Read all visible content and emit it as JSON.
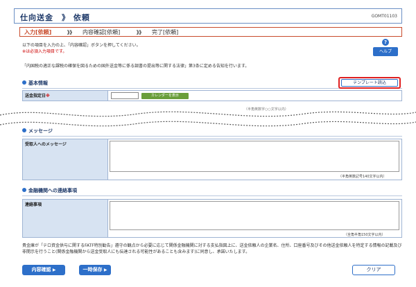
{
  "header": {
    "title": "仕向送金　》 依頼",
    "screen_id": "GOMT01103"
  },
  "steps": {
    "step1": "入力[依頼]",
    "sep": "》》",
    "step2": "内容確認[依頼]",
    "step3": "完了[依頼]"
  },
  "intro": {
    "line1": "以下の項目を入力の上、「内容確認」ボタンを押してください。",
    "line2": "※は必須入力項目です。",
    "law": "「内国税の適正な課税の確保を図るための国外送金等に係る調書の提出等に関する法律」第3条に定める告知を行います。"
  },
  "help": {
    "q": "?",
    "label": "ヘルプ"
  },
  "basic": {
    "title": "基本情報",
    "template_button": "テンプレート読込",
    "date_label": "送金指定日",
    "req_mark": "※",
    "calendar_button": "カレンダーを表示",
    "cutoff_note": "（半角英数字○○文字以内）"
  },
  "message": {
    "title": "メッセージ",
    "label": "受取人へのメッセージ",
    "note": "（半角英数記号140文字以内）"
  },
  "contact": {
    "title": "金融機関への連絡事項",
    "label": "連絡事項",
    "note": "（全角半角150文字以内）"
  },
  "footer": {
    "disclaimer": "貴金庫が「テロ資金供与に関するFATF特別勧告」遵守の観点から必要に応じて関係金融機関に対する支払指図上に、送金依頼人の企業名、住所、口座番号及びその他送金依頼人を特定する情報の記載及び非開示を行うこと(関係金融機関から送金受取人にも伝達される可能性があることも含みます)に同意し、承諾いたします。",
    "confirm_button": "内容確認",
    "save_button": "一時保存",
    "clear_button": "クリア",
    "arrow": "▶"
  }
}
